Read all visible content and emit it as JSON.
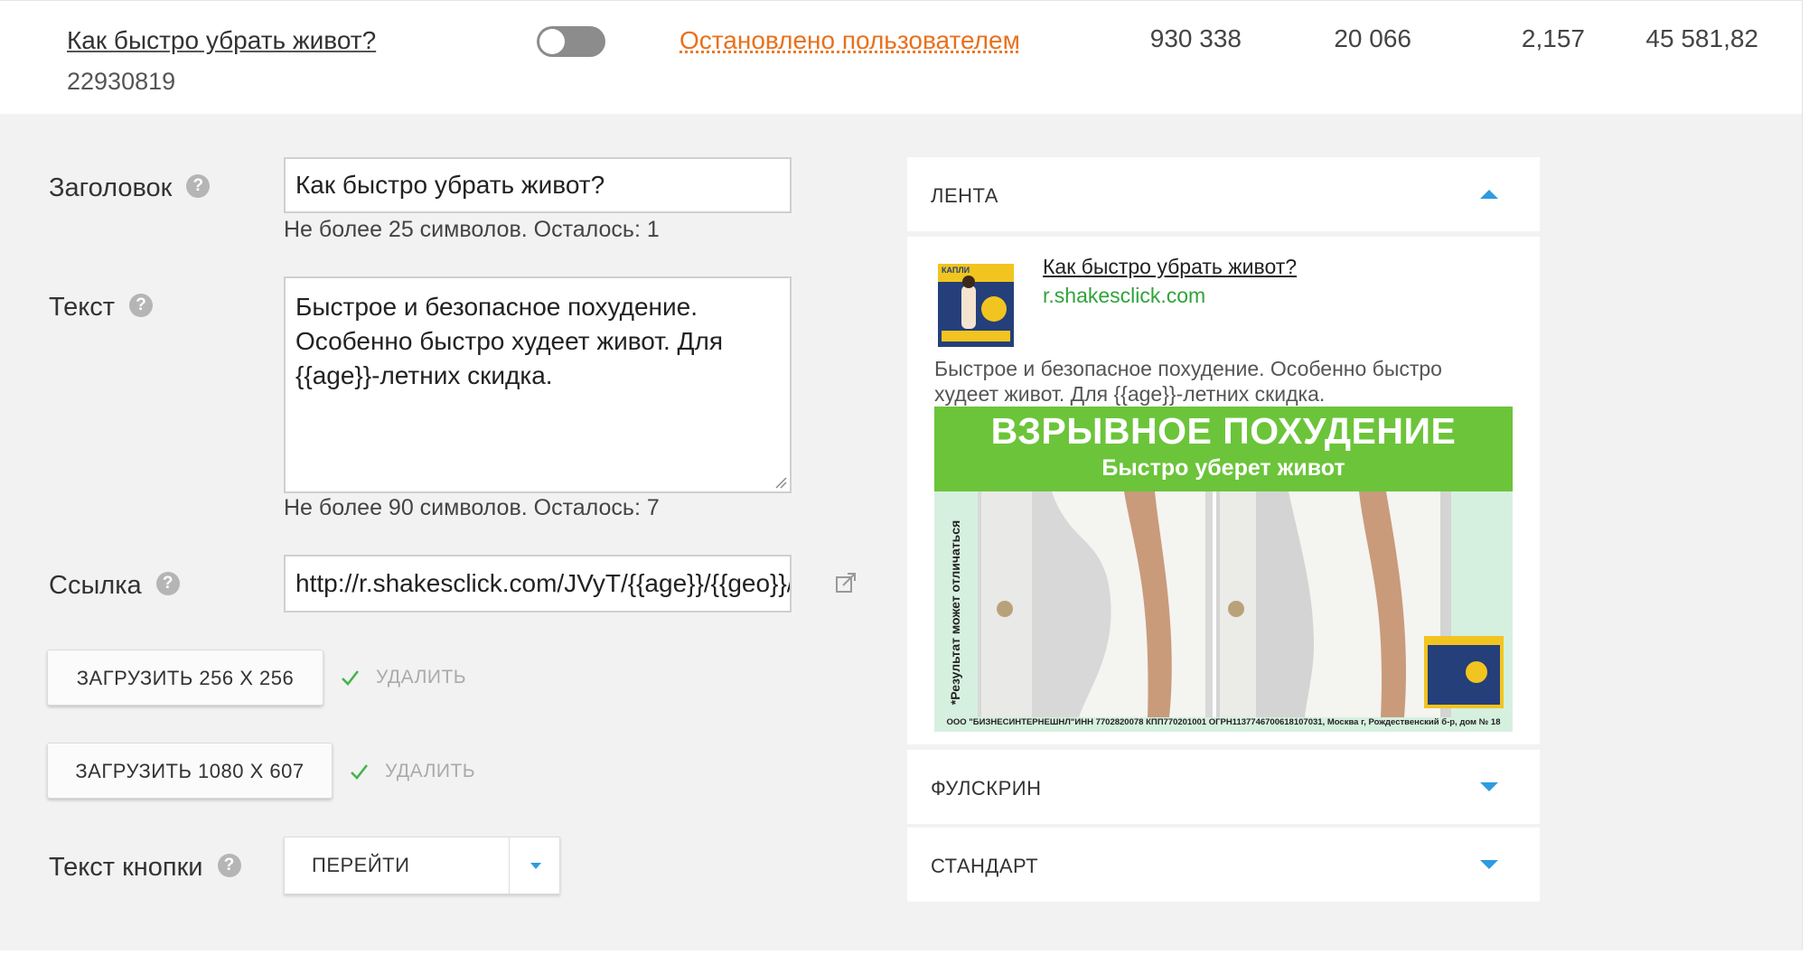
{
  "campaign": {
    "name": "Как быстро убрать живот?",
    "id": "22930819",
    "toggle_on": false,
    "status": "Остановлено пользователем",
    "stats": [
      "930 338",
      "20 066",
      "2,157",
      "45 581,82"
    ]
  },
  "colors": {
    "status": "#e8711d",
    "accent": "#2f9be0",
    "domain": "#2fa33a",
    "banner_green": "#6cc43a"
  },
  "form": {
    "title_label": "Заголовок",
    "title_value": "Как быстро убрать живот?",
    "title_hint": "Не более 25 символов. Осталось: 1",
    "text_label": "Текст",
    "text_value": "Быстрое и безопасное похудение. Особенно быстро худеет живот. Для {{age}}-летних скидка.",
    "text_hint": "Не более 90 символов. Осталось: 7",
    "link_label": "Ссылка",
    "link_value": "http://r.shakesclick.com/JVyT/{{age}}/{{geo}}/",
    "upload_small": "ЗАГРУЗИТЬ 256 X 256",
    "upload_large": "ЗАГРУЗИТЬ 1080 X 607",
    "delete_label": "УДАЛИТЬ",
    "button_text_label": "Текст кнопки",
    "button_text_value": "ПЕРЕЙТИ",
    "help_glyph": "?"
  },
  "preview": {
    "feed_tab": "ЛЕНТА",
    "fullscreen_tab": "ФУЛСКРИН",
    "standard_tab": "СТАНДАРТ",
    "title": "Как быстро убрать живот?",
    "domain": "r.shakesclick.com",
    "text": "Быстрое и безопасное похудение. Особенно быстро худеет живот. Для {{age}}-летних скидка.",
    "banner_headline": "ВЗРЫВНОЕ ПОХУДЕНИЕ",
    "banner_subline": "Быстро уберет живот",
    "banner_disclaimer": "*Результат может отличаться",
    "banner_footer": "ООО \"БИЗНЕСИНТЕРНЕШНЛ\"ИНН 7702820078 КПП770201001 ОГРН1137746700618107031, Москва г, Рождественский б-р, дом № 18",
    "product_label": "КАПЛИ"
  }
}
